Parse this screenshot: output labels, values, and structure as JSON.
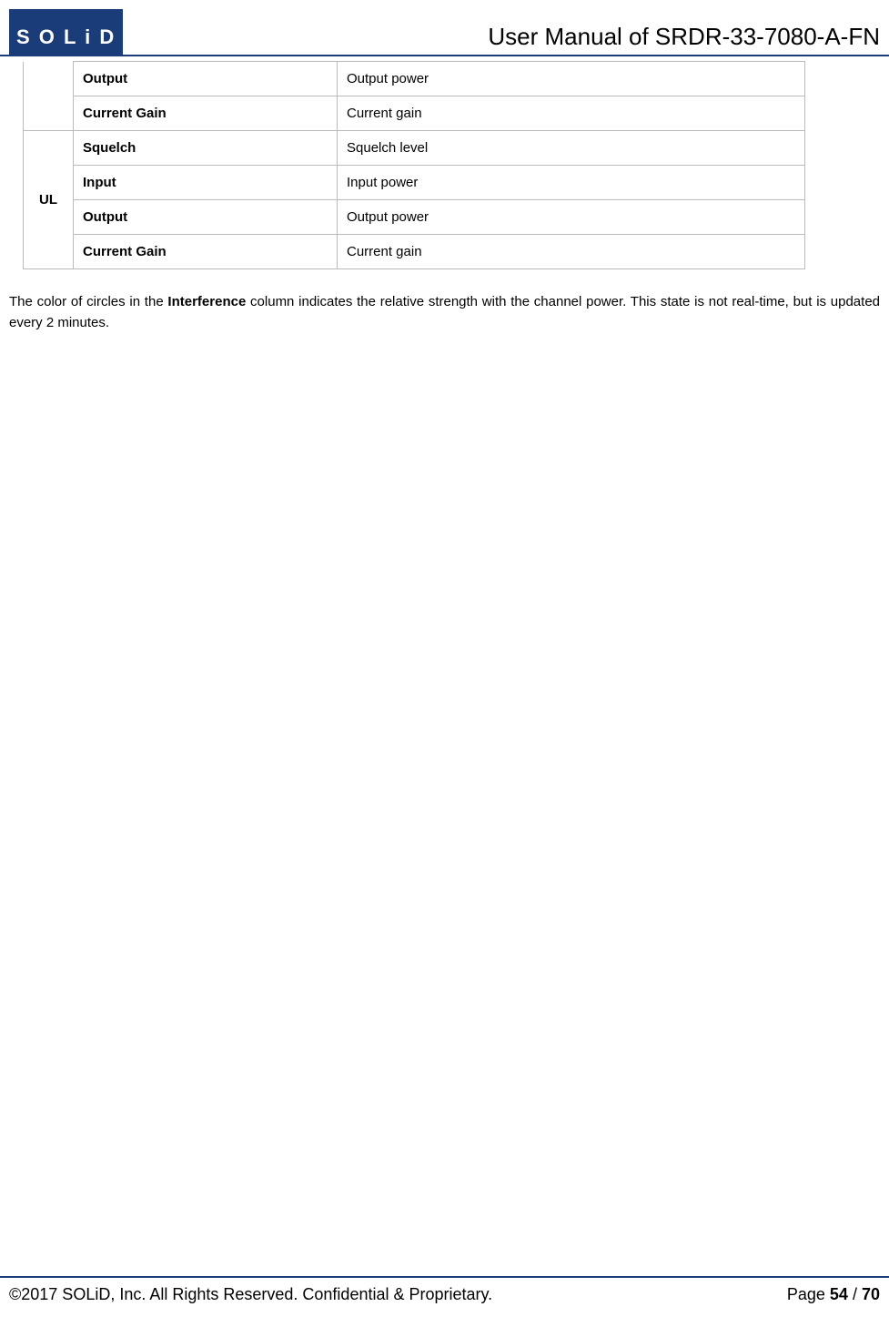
{
  "header": {
    "logo": "S O L i D",
    "title": "User Manual of SRDR-33-7080-A-FN"
  },
  "table": {
    "rows": [
      {
        "group": "",
        "label": "Output",
        "desc": "Output power",
        "emptyGroup": true
      },
      {
        "group": "",
        "label": "Current Gain",
        "desc": "Current gain",
        "emptyGroup": true
      },
      {
        "group": "UL",
        "label": "Squelch",
        "desc": "Squelch level",
        "rowspan": 4
      },
      {
        "group": "",
        "label": "Input",
        "desc": "Input power"
      },
      {
        "group": "",
        "label": "Output",
        "desc": "Output power"
      },
      {
        "group": "",
        "label": "Current Gain",
        "desc": "Current gain"
      }
    ]
  },
  "paragraph": {
    "part1": "The color of circles in the ",
    "bold": "Interference",
    "part2": " column indicates the relative strength with the channel power. This state is not real-time, but is updated every 2 minutes."
  },
  "footer": {
    "copyright": "©2017 SOLiD, Inc. All Rights Reserved. Confidential & Proprietary.",
    "pageLabel": "Page ",
    "pageCurrent": "54",
    "pageSep": " / ",
    "pageTotal": "70"
  }
}
